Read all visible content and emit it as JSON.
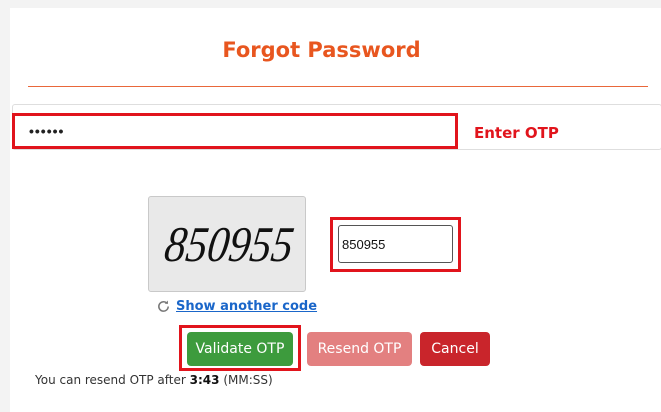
{
  "title": "Forgot Password",
  "otp": {
    "value": "••••••",
    "label": "Enter OTP"
  },
  "captcha": {
    "image_text": "850955",
    "input_value": "850955",
    "refresh_label": "Show another code",
    "refresh_icon": "refresh-icon"
  },
  "buttons": {
    "validate": "Validate OTP",
    "resend": "Resend OTP",
    "cancel": "Cancel"
  },
  "resend_note": {
    "prefix": "You can resend OTP after",
    "time": "3:43",
    "suffix": "(MM:SS)"
  },
  "colors": {
    "title": "#e8561f",
    "highlight": "#e1141c",
    "validate": "#3d9b3d",
    "resend": "#e38080",
    "cancel": "#c9252b",
    "link": "#1a66c9"
  }
}
